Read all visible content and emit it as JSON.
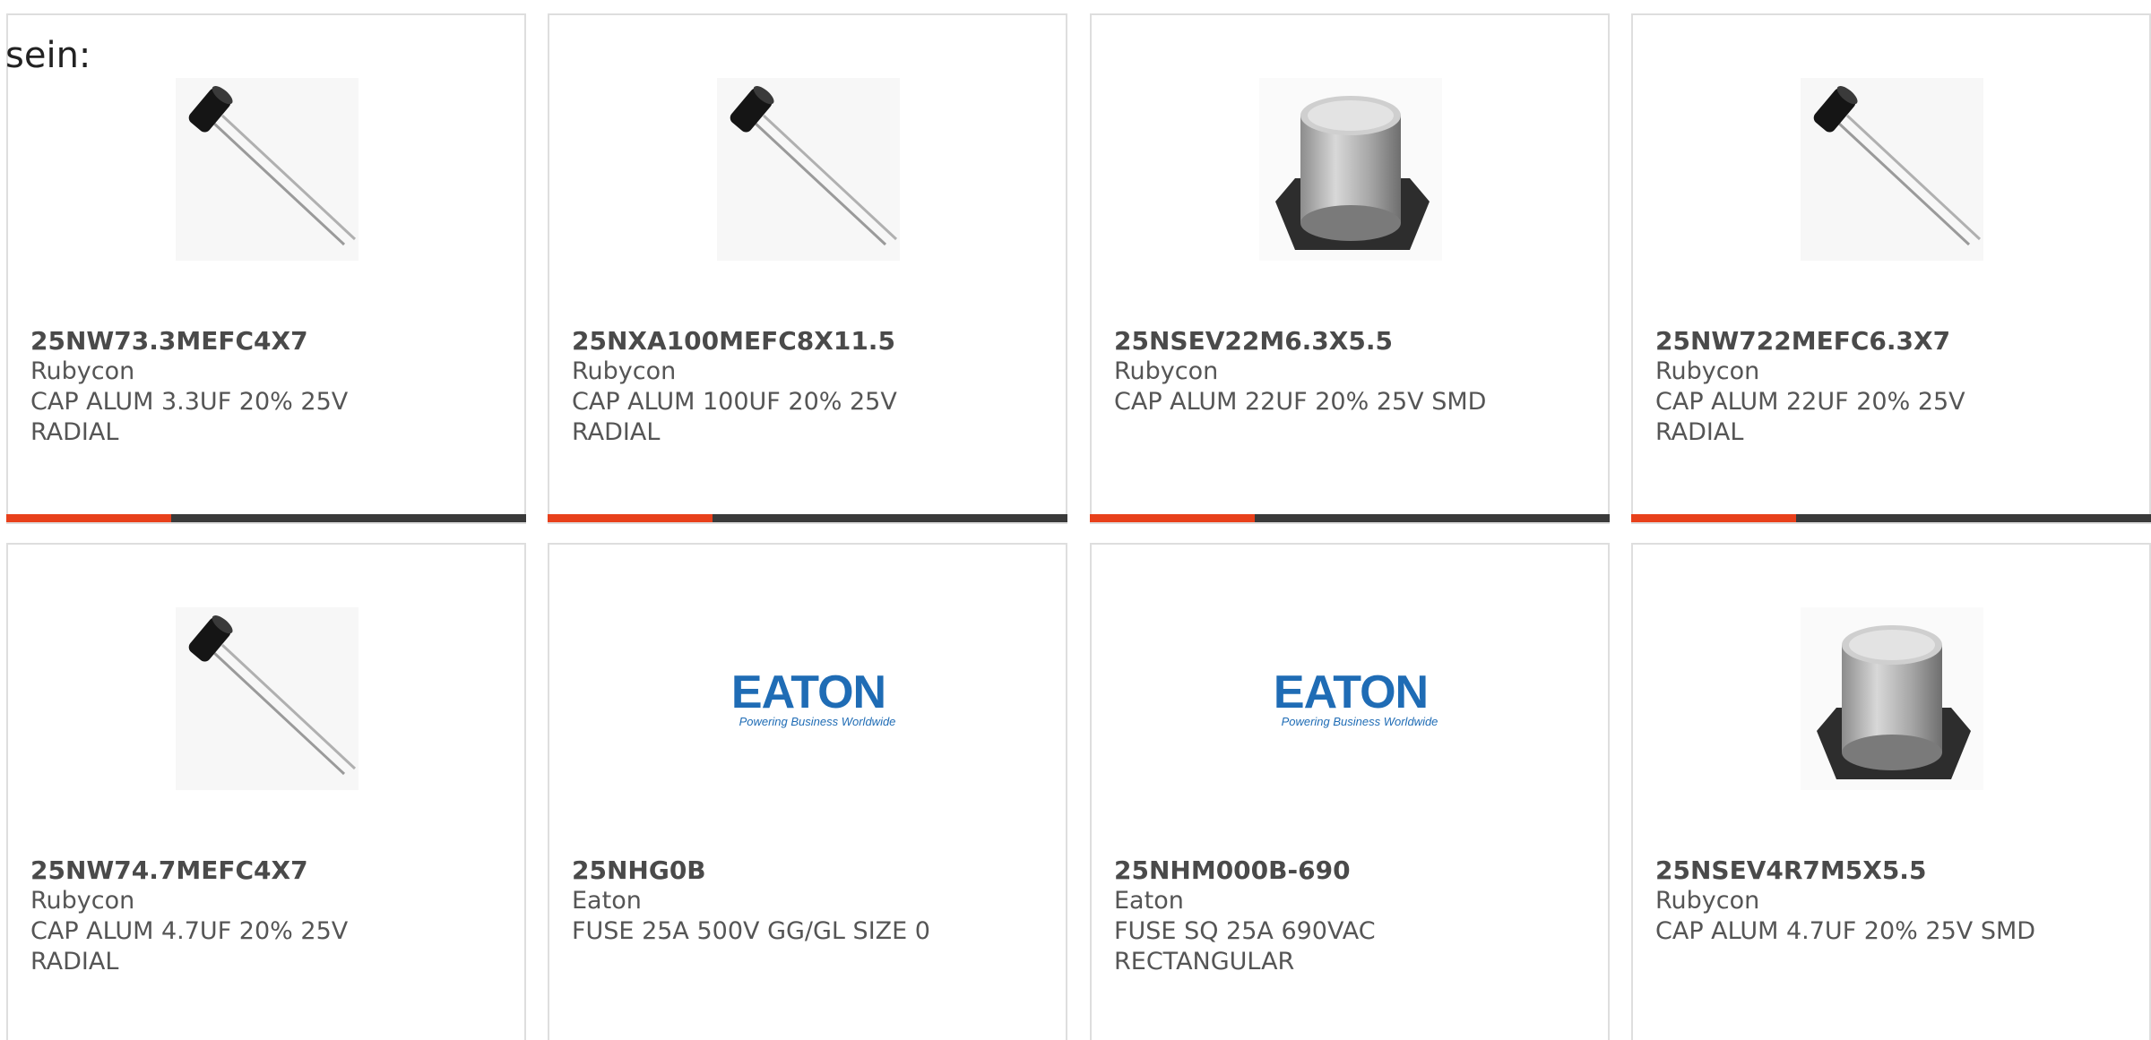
{
  "intro_text": "sein:",
  "colors": {
    "accent": "#e8401b",
    "bar": "#3a3a3a",
    "text": "#555555",
    "border": "#dedede",
    "eaton_blue": "#1f6cb5"
  },
  "products": [
    {
      "part_number": "25NW73.3MEFC4X7",
      "manufacturer": "Rubycon",
      "description_line1": "CAP ALUM 3.3UF 20% 25V",
      "description_line2": "RADIAL",
      "image": "radial-capacitor-icon"
    },
    {
      "part_number": "25NXA100MEFC8X11.5",
      "manufacturer": "Rubycon",
      "description_line1": "CAP ALUM 100UF 20% 25V",
      "description_line2": "RADIAL",
      "image": "radial-capacitor-icon"
    },
    {
      "part_number": "25NSEV22M6.3X5.5",
      "manufacturer": "Rubycon",
      "description_line1": "CAP ALUM 22UF 20% 25V SMD",
      "description_line2": "",
      "image": "smd-capacitor-icon"
    },
    {
      "part_number": "25NW722MEFC6.3X7",
      "manufacturer": "Rubycon",
      "description_line1": "CAP ALUM 22UF 20% 25V",
      "description_line2": "RADIAL",
      "image": "radial-capacitor-icon"
    },
    {
      "part_number": "25NW74.7MEFC4X7",
      "manufacturer": "Rubycon",
      "description_line1": "CAP ALUM 4.7UF 20% 25V",
      "description_line2": "RADIAL",
      "image": "radial-capacitor-icon"
    },
    {
      "part_number": "25NHG0B",
      "manufacturer": "Eaton",
      "description_line1": "FUSE 25A 500V GG/GL SIZE 0",
      "description_line2": "",
      "image": "eaton-logo",
      "logo_text": "EATON",
      "logo_tagline": "Powering Business Worldwide"
    },
    {
      "part_number": "25NHM000B-690",
      "manufacturer": "Eaton",
      "description_line1": "FUSE SQ 25A 690VAC",
      "description_line2": "RECTANGULAR",
      "image": "eaton-logo",
      "logo_text": "EATON",
      "logo_tagline": "Powering Business Worldwide"
    },
    {
      "part_number": "25NSEV4R7M5X5.5",
      "manufacturer": "Rubycon",
      "description_line1": "CAP ALUM 4.7UF 20% 25V SMD",
      "description_line2": "",
      "image": "smd-capacitor-icon"
    }
  ]
}
